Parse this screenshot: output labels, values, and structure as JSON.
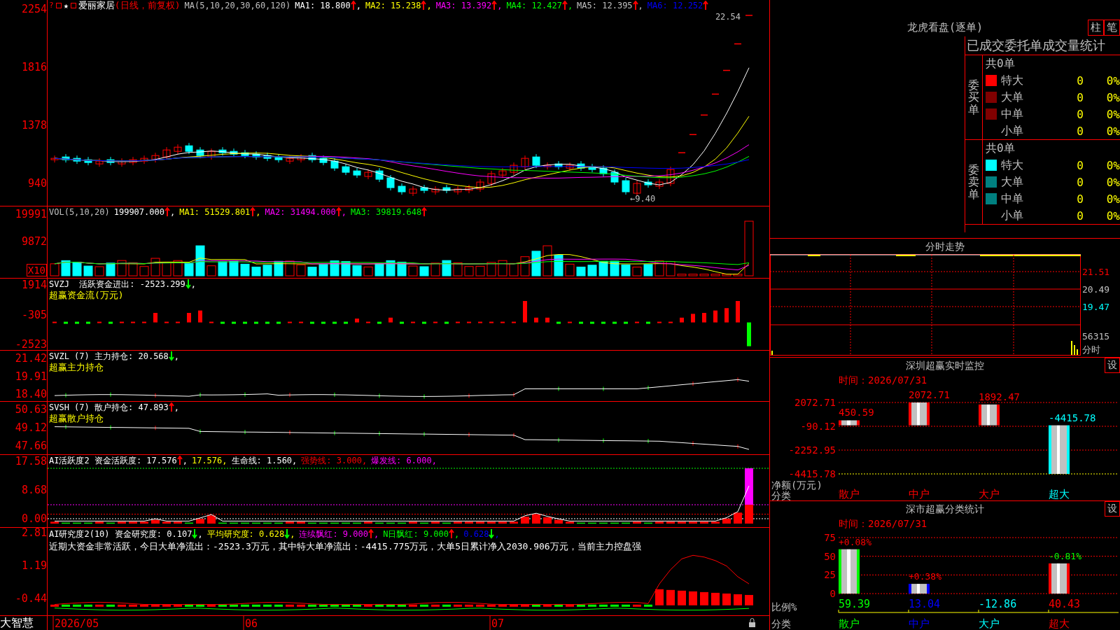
{
  "left_panels": [
    {
      "kind": "price",
      "ticks": [
        "2254",
        "1816",
        "1378",
        "940"
      ],
      "corner_mark": "?",
      "star": "★",
      "stock_name": "爱丽家居",
      "period": "(日线，前复权)",
      "high_label": "22.54",
      "low_label": "←9.40",
      "legend": [
        {
          "kind": "label",
          "text": "MA(5,10,20,30,60,120)",
          "color": "#c0c0c0"
        },
        {
          "kind": "label",
          "text": "MA1: 18.800",
          "color": "#ffffff"
        },
        {
          "kind": "up_arrow",
          "color": "#ff0000"
        },
        {
          "kind": "separator",
          "text": ","
        },
        {
          "kind": "label",
          "text": "MA2: 15.238",
          "color": "#ffff00"
        },
        {
          "kind": "up_arrow",
          "color": "#ff0000"
        },
        {
          "kind": "separator",
          "text": ","
        },
        {
          "kind": "label",
          "text": "MA3: 13.392",
          "color": "#ff00ff"
        },
        {
          "kind": "up_arrow",
          "color": "#ff0000"
        },
        {
          "kind": "separator",
          "text": ","
        },
        {
          "kind": "label",
          "text": "MA4: 12.427",
          "color": "#00ff00"
        },
        {
          "kind": "up_arrow",
          "color": "#ff0000"
        },
        {
          "kind": "separator",
          "text": ","
        },
        {
          "kind": "label",
          "text": "MA5: 12.395",
          "color": "#c0c0c0"
        },
        {
          "kind": "up_arrow",
          "color": "#ff0000"
        },
        {
          "kind": "separator",
          "text": ","
        },
        {
          "kind": "label",
          "text": "MA6: 12.252",
          "color": "#0000ff"
        },
        {
          "kind": "up_arrow",
          "color": "#ff0000"
        }
      ]
    },
    {
      "kind": "volume",
      "ticks": [
        "19991",
        "9872"
      ],
      "scale_badge": "X10",
      "legend": [
        {
          "kind": "label",
          "text": "VOL(5,10,20)",
          "color": "#c0c0c0"
        },
        {
          "kind": "label",
          "text": "199907.000",
          "color": "#ffffff"
        },
        {
          "kind": "up_arrow",
          "color": "#ff0000"
        },
        {
          "kind": "separator",
          "text": ","
        },
        {
          "kind": "label",
          "text": "MA1: 51529.801",
          "color": "#ffff00"
        },
        {
          "kind": "up_arrow",
          "color": "#ff0000"
        },
        {
          "kind": "separator",
          "text": ","
        },
        {
          "kind": "label",
          "text": "MA2: 31494.000",
          "color": "#ff00ff"
        },
        {
          "kind": "up_arrow",
          "color": "#ff0000"
        },
        {
          "kind": "separator",
          "text": ","
        },
        {
          "kind": "label",
          "text": "MA3: 39819.648",
          "color": "#00ff00"
        },
        {
          "kind": "up_arrow",
          "color": "#ff0000"
        }
      ]
    },
    {
      "kind": "flow",
      "ticks": [
        "1914",
        "-305",
        "-2523"
      ],
      "caption": "超赢资金流(万元)",
      "legend": [
        {
          "kind": "label",
          "text": "SVZJ  活跃资金进出: -2523.299",
          "color": "#ffffff"
        },
        {
          "kind": "down_arrow",
          "color": "#00ff00"
        },
        {
          "kind": "separator",
          "text": ","
        }
      ]
    },
    {
      "kind": "main_hold",
      "ticks": [
        "21.42",
        "19.91",
        "18.40"
      ],
      "caption": "超赢主力持仓",
      "legend": [
        {
          "kind": "label",
          "text": "SVZL (7) 主力持仓: 20.568",
          "color": "#ffffff"
        },
        {
          "kind": "down_arrow",
          "color": "#00ff00"
        },
        {
          "kind": "separator",
          "text": ","
        }
      ]
    },
    {
      "kind": "retail_hold",
      "ticks": [
        "50.63",
        "49.12",
        "47.66"
      ],
      "caption": "超赢散户持仓",
      "legend": [
        {
          "kind": "label",
          "text": "SVSH (7) 散户持仓: 47.893",
          "color": "#ffffff"
        },
        {
          "kind": "up_arrow",
          "color": "#ff0000"
        },
        {
          "kind": "separator",
          "text": ","
        }
      ]
    },
    {
      "kind": "activity",
      "ticks": [
        "17.58",
        "8.68",
        "0.00"
      ],
      "legend": [
        {
          "kind": "label",
          "text": "AI活跃度2 资金活跃度: 17.576",
          "color": "#ffffff"
        },
        {
          "kind": "up_arrow",
          "color": "#ff0000"
        },
        {
          "kind": "separator",
          "text": ","
        },
        {
          "kind": "label",
          "text": "17.576,",
          "color": "#ffff00"
        },
        {
          "kind": "label",
          "text": "生命线: 1.560,",
          "color": "#ffffff"
        },
        {
          "kind": "label",
          "text": "强势线: 3.000,",
          "color": "#ff0000"
        },
        {
          "kind": "label",
          "text": "爆发线: 6.000,",
          "color": "#ff00ff"
        }
      ]
    },
    {
      "kind": "research",
      "ticks": [
        "2.81",
        "1.19",
        "-0.44"
      ],
      "note": "近期大资金非常活跃，今日大单净流出：-2523.3万元，其中特大单净流出：-4415.775万元，大单5日累计净入2030.906万元，当前主力控盘强",
      "legend": [
        {
          "kind": "label",
          "text": "AI研究度2(10) 资金研究度: 0.107",
          "color": "#ffffff"
        },
        {
          "kind": "down_arrow",
          "color": "#00ff00"
        },
        {
          "kind": "separator",
          "text": ","
        },
        {
          "kind": "label",
          "text": "平均研究度: 0.628",
          "color": "#ffff00"
        },
        {
          "kind": "down_arrow",
          "color": "#00ff00"
        },
        {
          "kind": "separator",
          "text": ","
        },
        {
          "kind": "label",
          "text": "连续飘红: 9.000",
          "color": "#ff00ff"
        },
        {
          "kind": "up_arrow",
          "color": "#ff0000"
        },
        {
          "kind": "separator",
          "text": ","
        },
        {
          "kind": "label",
          "text": "N日飘红: 9.000",
          "color": "#00ff00"
        },
        {
          "kind": "up_arrow",
          "color": "#ff0000"
        },
        {
          "kind": "separator",
          "text": ","
        },
        {
          "kind": "label",
          "text": "0.628",
          "color": "#0000ff"
        },
        {
          "kind": "down_arrow",
          "color": "#00ff00"
        },
        {
          "kind": "separator",
          "text": ","
        }
      ]
    }
  ],
  "date_axis": {
    "brand": "大智慧",
    "dates": [
      "2026/05",
      "06",
      "07"
    ]
  },
  "order_stats": {
    "title": "龙虎看盘(逐单)",
    "buttons": [
      "柱",
      "笔"
    ],
    "heading": "已成交委托单成交量统计",
    "groups": [
      {
        "label": "委买单",
        "total": "共0单",
        "rows": [
          {
            "name": "特大",
            "color": "#ff0000",
            "count": "0",
            "share": "0%"
          },
          {
            "name": "大单",
            "color": "#800000",
            "count": "0",
            "share": "0%"
          },
          {
            "name": "中单",
            "color": "#800000",
            "count": "0",
            "share": "0%"
          },
          {
            "name": "小单",
            "count": "0",
            "share": "0%"
          }
        ]
      },
      {
        "label": "委卖单",
        "total": "共0单",
        "rows": [
          {
            "name": "特大",
            "color": "#00ffff",
            "count": "0",
            "share": "0%"
          },
          {
            "name": "大单",
            "color": "#008080",
            "count": "0",
            "share": "0%"
          },
          {
            "name": "中单",
            "color": "#008080",
            "count": "0",
            "share": "0%"
          },
          {
            "name": "小单",
            "count": "0",
            "share": "0%"
          }
        ]
      }
    ]
  },
  "intraday": {
    "title": "分时走势",
    "price_ticks": [
      {
        "label": "21.51",
        "color": "#ff0000"
      },
      {
        "label": "20.49",
        "color": "#c0c0c0"
      },
      {
        "label": "19.47",
        "color": "#00ffff"
      }
    ],
    "volume_tick": "56315",
    "axis_label": "分时"
  },
  "sz_monitor": {
    "title": "深圳超赢实时监控",
    "settings_button": "设",
    "time": "时间：2026/07/31",
    "side_labels": [
      "净额(万元)",
      "分类"
    ],
    "bars": [
      {
        "color": "#ff0000"
      },
      {
        "color": "#ff0000"
      },
      {
        "color": "#ff0000"
      },
      {
        "color": "#00ffff"
      }
    ],
    "chart_data": {
      "type": "bar",
      "categories": [
        "散户",
        "中户",
        "大户",
        "超大"
      ],
      "values": [
        450.59,
        2072.71,
        1892.47,
        -4415.78
      ],
      "ylim": [
        -4415.78,
        2072.71
      ],
      "yticks": [
        2072.71,
        -90.12,
        -2252.95,
        -4415.78
      ],
      "data_labels": true
    }
  },
  "sz_category": {
    "title": "深市超赢分类统计",
    "settings_button": "设",
    "time": "时间：2026/07/31",
    "side_labels": [
      "比例%",
      "分类"
    ],
    "bars": [
      {
        "color": "#00ff00",
        "change": {
          "text": "+0.08%",
          "color": "#ff0000"
        }
      },
      {
        "color": "#0000ff",
        "change": {
          "text": "+0.38%",
          "color": "#ff0000"
        }
      },
      {
        "color": "#00ffff"
      },
      {
        "color": "#ff0000",
        "change": {
          "text": "-0.81%",
          "color": "#00ff00"
        }
      }
    ],
    "chart_data": {
      "type": "bar",
      "categories": [
        "散户",
        "中户",
        "大户",
        "超大"
      ],
      "values": [
        59.39,
        13.04,
        null,
        40.43
      ],
      "value_labels": [
        "59.39",
        "13.04",
        "-12.86",
        "40.43"
      ],
      "ylim": [
        0,
        75
      ],
      "yticks": [
        0,
        25,
        50,
        75
      ]
    }
  }
}
